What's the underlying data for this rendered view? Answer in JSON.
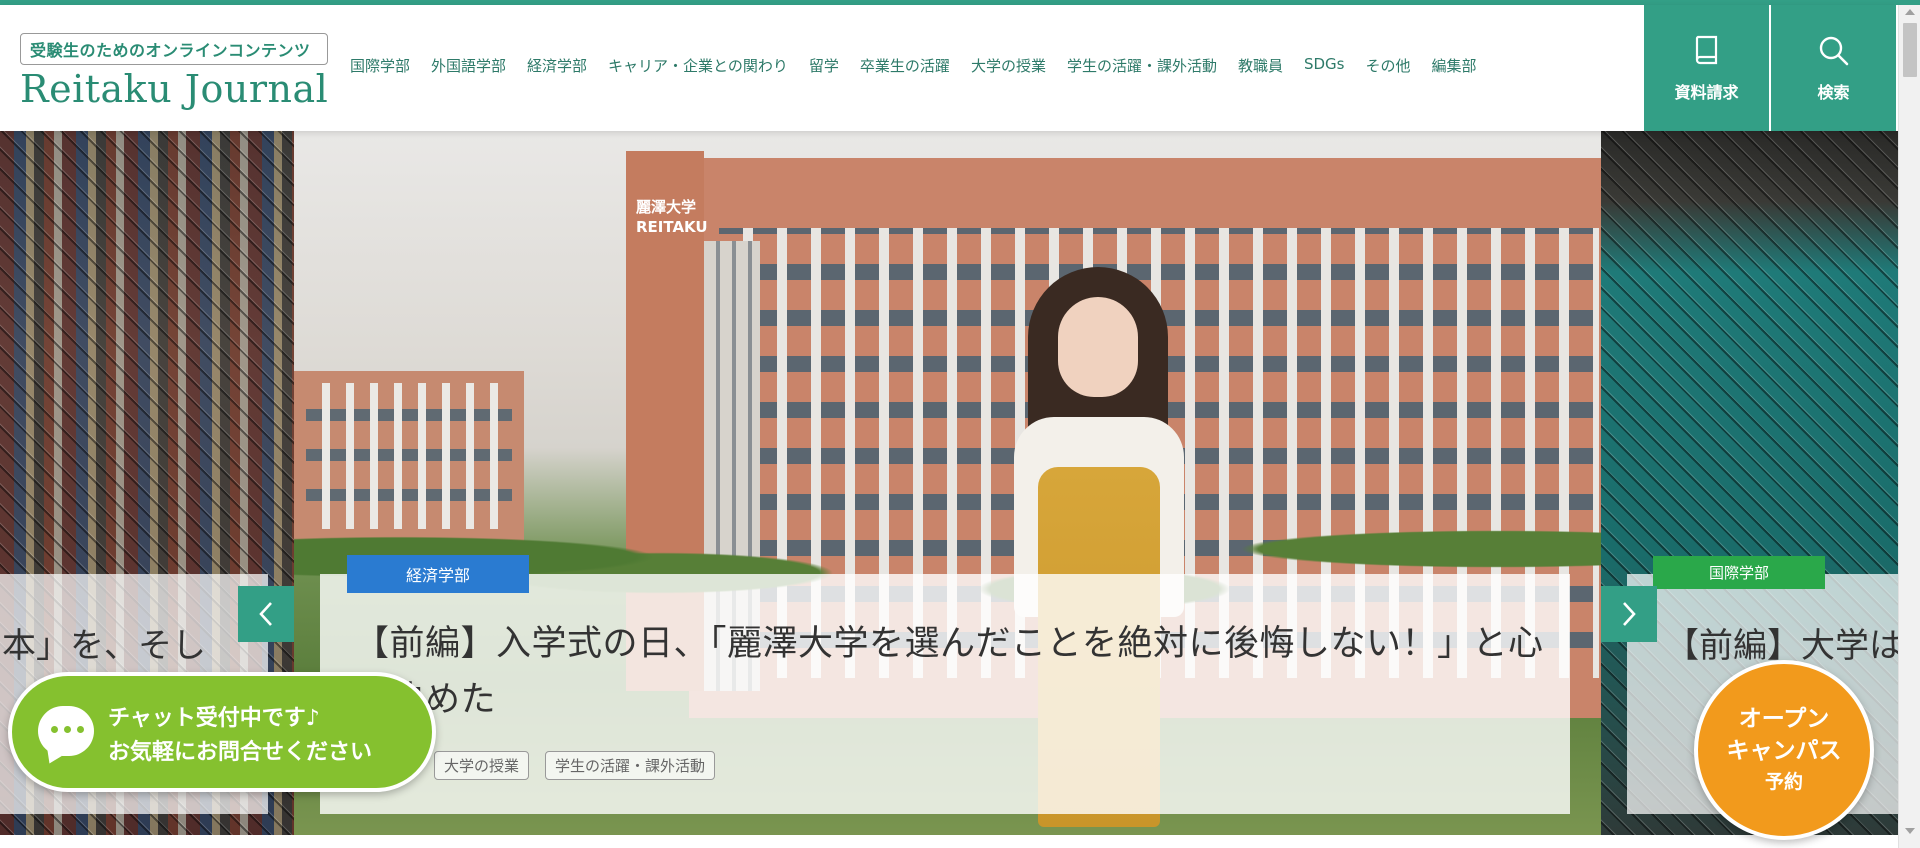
{
  "header": {
    "tagline": "受験生のためのオンラインコンテンツ",
    "site_name": "Reitaku Journal",
    "nav": [
      "国際学部",
      "外国語学部",
      "経済学部",
      "キャリア・企業との関わり",
      "留学",
      "卒業生の活躍",
      "大学の授業",
      "学生の活躍・課外活動",
      "教職員",
      "SDGs",
      "その他",
      "編集部"
    ],
    "request_label": "資料請求",
    "search_label": "検索"
  },
  "slider": {
    "main": {
      "category": "経済学部",
      "title": "【前編】入学式の日、「麗澤大学を選んだことを絶対に後悔しない！」と心に決めた",
      "tags": [
        "大学の授業",
        "学生の活躍・課外活動"
      ],
      "building_sign": "麗澤大学 REITAKU"
    },
    "prev": {
      "title_fragment": "本」を、そし"
    },
    "next": {
      "category": "国際学部",
      "title_fragment": "【前編】大学は"
    }
  },
  "chat": {
    "line1": "チャット受付中です♪",
    "line2": "お気軽にお問合せください"
  },
  "open_campus": {
    "line1": "オープン",
    "line2": "キャンパス",
    "line3": "予約"
  },
  "colors": {
    "brand_green": "#339f86",
    "main_category": "#2a7bd1",
    "chat_green": "#85c12f",
    "open_campus_orange": "#f29a1c"
  },
  "icons": {
    "request": "book-icon",
    "search": "search-icon",
    "prev": "chevron-left-icon",
    "next": "chevron-right-icon",
    "chat": "chat-bubble-icon"
  }
}
